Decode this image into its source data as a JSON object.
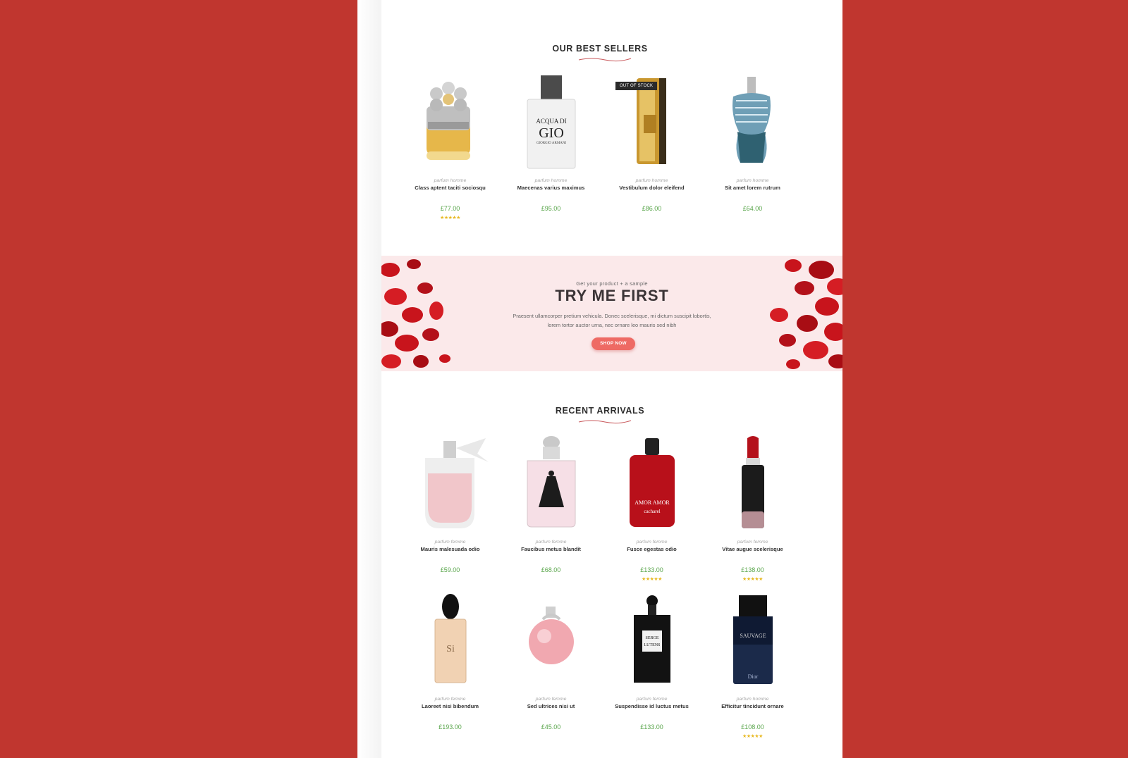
{
  "best_sellers": {
    "title": "OUR BEST SELLERS",
    "products": [
      {
        "category": "parfum homme",
        "name": "Class aptent taciti sociosqu",
        "price": "£77.00",
        "stars": "★★★★★",
        "badge": "",
        "icon": "bottle-gold-revolver"
      },
      {
        "category": "parfum homme",
        "name": "Maecenas varius maximus",
        "price": "£95.00",
        "stars": "",
        "badge": "",
        "icon": "bottle-acqua-di-gio"
      },
      {
        "category": "parfum homme",
        "name": "Vestibulum dolor eleifend",
        "price": "£86.00",
        "stars": "",
        "badge": "OUT OF STOCK",
        "icon": "bottle-gold-bar"
      },
      {
        "category": "parfum homme",
        "name": "Sit amet lorem rutrum",
        "price": "£64.00",
        "stars": "",
        "badge": "",
        "icon": "bottle-torso"
      }
    ]
  },
  "banner": {
    "pretitle": "Get your product + a sample",
    "title": "TRY ME FIRST",
    "text_line1": "Praesent ullamcorper pretium vehicula. Donec scelerisque, mi dictum suscipit lobortis,",
    "text_line2": "lorem tortor auctor urna, nec ornare leo mauris sed nibh",
    "button": "SHOP NOW"
  },
  "recent_arrivals": {
    "title": "RECENT ARRIVALS",
    "products": [
      {
        "category": "parfum femme",
        "name": "Mauris malesuada odio",
        "price": "£59.00",
        "stars": "",
        "icon": "bottle-pink-bow"
      },
      {
        "category": "parfum femme",
        "name": "Faucibus metus blandit",
        "price": "£68.00",
        "stars": "",
        "icon": "bottle-black-dress"
      },
      {
        "category": "parfum femme",
        "name": "Fusce egestas odio",
        "price": "£133.00",
        "stars": "★★★★★",
        "icon": "bottle-red-amor"
      },
      {
        "category": "parfum femme",
        "name": "Vitae augue scelerisque",
        "price": "£138.00",
        "stars": "★★★★★",
        "icon": "bottle-lipstick"
      },
      {
        "category": "parfum femme",
        "name": "Laoreet nisi bibendum",
        "price": "£193.00",
        "stars": "",
        "icon": "bottle-si"
      },
      {
        "category": "parfum femme",
        "name": "Sed ultrices nisi ut",
        "price": "£45.00",
        "stars": "",
        "icon": "bottle-apple"
      },
      {
        "category": "parfum femme",
        "name": "Suspendisse id luctus metus",
        "price": "£133.00",
        "stars": "",
        "icon": "bottle-serge-lutens"
      },
      {
        "category": "parfum homme",
        "name": "Efficitur tincidunt ornare",
        "price": "£108.00",
        "stars": "★★★★★",
        "icon": "bottle-sauvage"
      }
    ]
  },
  "bottle_labels": {
    "acqua_1": "ACQUA DI",
    "acqua_2": "GIO",
    "acqua_3": "GIORGIO ARMANI",
    "amor_1": "AMOR AMOR",
    "amor_2": "cacharel",
    "si": "Si",
    "serge_1": "SERGE",
    "serge_2": "LUTENS",
    "sauvage_1": "SAUVAGE",
    "sauvage_2": "Dior"
  },
  "colors": {
    "background": "#c0362f",
    "price": "#5aa64c",
    "stars": "#e8b923",
    "button": "#ee6a64",
    "banner_bg": "#fbe9ea"
  }
}
